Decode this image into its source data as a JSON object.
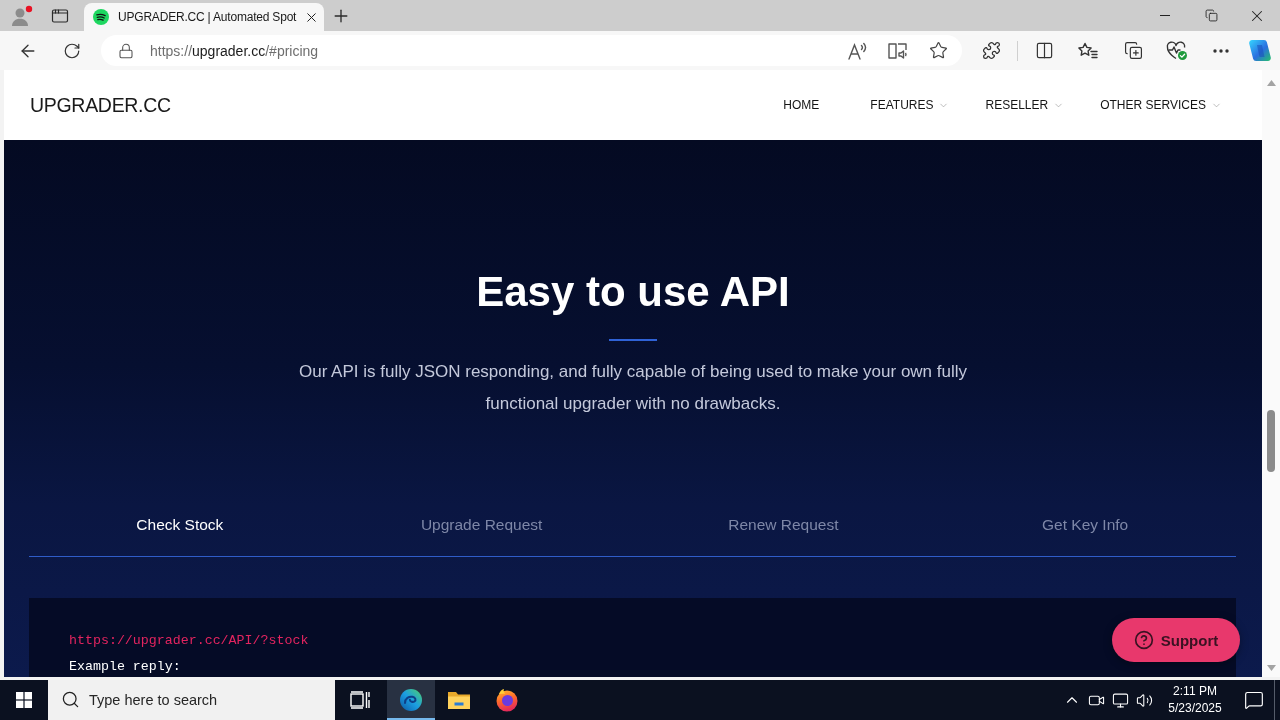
{
  "browser": {
    "tabs": [
      {
        "title": "UPGRADER.CC | Automated Spot",
        "selected": true
      }
    ],
    "address": {
      "scheme": "https://",
      "host": "upgrader.cc",
      "path": "/#pricing"
    }
  },
  "site_header": {
    "logo": "UPGRADER.CC",
    "nav": [
      {
        "label": "HOME",
        "dropdown": false
      },
      {
        "label": "FEATURES",
        "dropdown": true
      },
      {
        "label": "RESELLER",
        "dropdown": true
      },
      {
        "label": "OTHER SERVICES",
        "dropdown": true
      }
    ]
  },
  "api_section": {
    "title": "Easy to use API",
    "description": "Our API is fully JSON responding, and fully capable of being used to make your own fully functional upgrader with no drawbacks.",
    "tabs": [
      {
        "label": "Check Stock",
        "selected": true
      },
      {
        "label": "Upgrade Request",
        "selected": false
      },
      {
        "label": "Renew Request",
        "selected": false
      },
      {
        "label": "Get Key Info",
        "selected": false
      }
    ],
    "code": {
      "request": "https://upgrader.cc/API/?stock",
      "lines": [
        "Example reply:"
      ]
    }
  },
  "support_button": {
    "label": "Support"
  },
  "taskbar": {
    "search": {
      "placeholder": "Type here to search"
    },
    "apps": [
      {
        "kind": "edge",
        "selected": true
      },
      {
        "kind": "explorer",
        "selected": false
      },
      {
        "kind": "firefox",
        "selected": false
      }
    ],
    "clock": {
      "time": "2:11 PM",
      "date": "5/23/2025"
    }
  }
}
